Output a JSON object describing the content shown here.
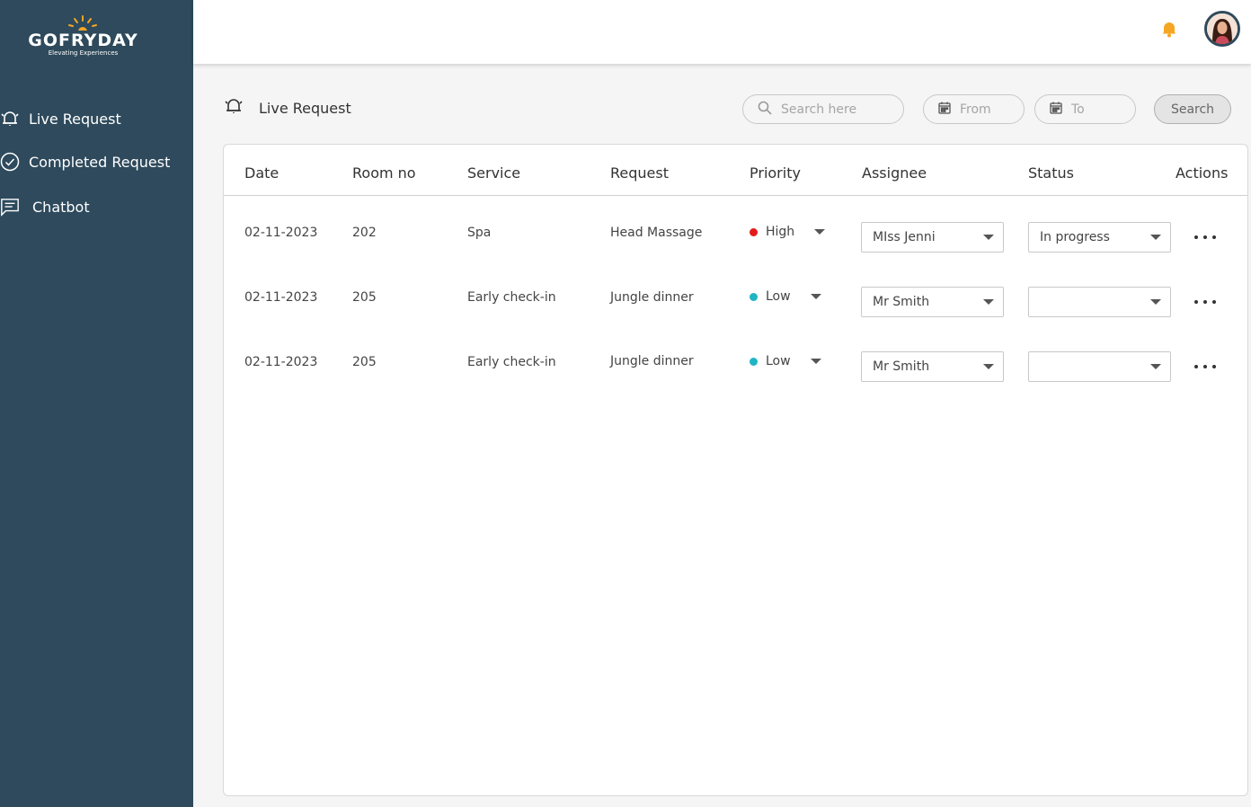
{
  "brand": {
    "name": "GOFRYDAY",
    "tagline": "Elevating Experiences",
    "accent": "#f5a623"
  },
  "sidebar": {
    "items": [
      {
        "label": "Live Request",
        "icon": "bell-alarm-icon"
      },
      {
        "label": "Completed Request",
        "icon": "check-circle-icon"
      },
      {
        "label": "Chatbot",
        "icon": "chat-icon"
      }
    ]
  },
  "page": {
    "title": "Live Request"
  },
  "filters": {
    "search_placeholder": "Search here",
    "from_placeholder": "From",
    "to_placeholder": "To",
    "search_button": "Search"
  },
  "table": {
    "headers": [
      "Date",
      "Room no",
      "Service",
      "Request",
      "Priority",
      "Assignee",
      "Status",
      "Actions"
    ],
    "rows": [
      {
        "date": "02-11-2023",
        "room": "202",
        "service": "Spa",
        "request": "Head Massage",
        "priority": "High",
        "priority_color": "#e41b1b",
        "assignee": "MIss Jenni",
        "status": "In progress"
      },
      {
        "date": "02-11-2023",
        "room": "205",
        "service": "Early check-in",
        "request": "Jungle dinner",
        "priority": "Low",
        "priority_color": "#1fb5c4",
        "assignee": "Mr Smith",
        "status": ""
      },
      {
        "date": "02-11-2023",
        "room": "205",
        "service": "Early check-in",
        "request": "Jungle dinner",
        "priority": "Low",
        "priority_color": "#1fb5c4",
        "assignee": "Mr Smith",
        "status": ""
      }
    ]
  }
}
